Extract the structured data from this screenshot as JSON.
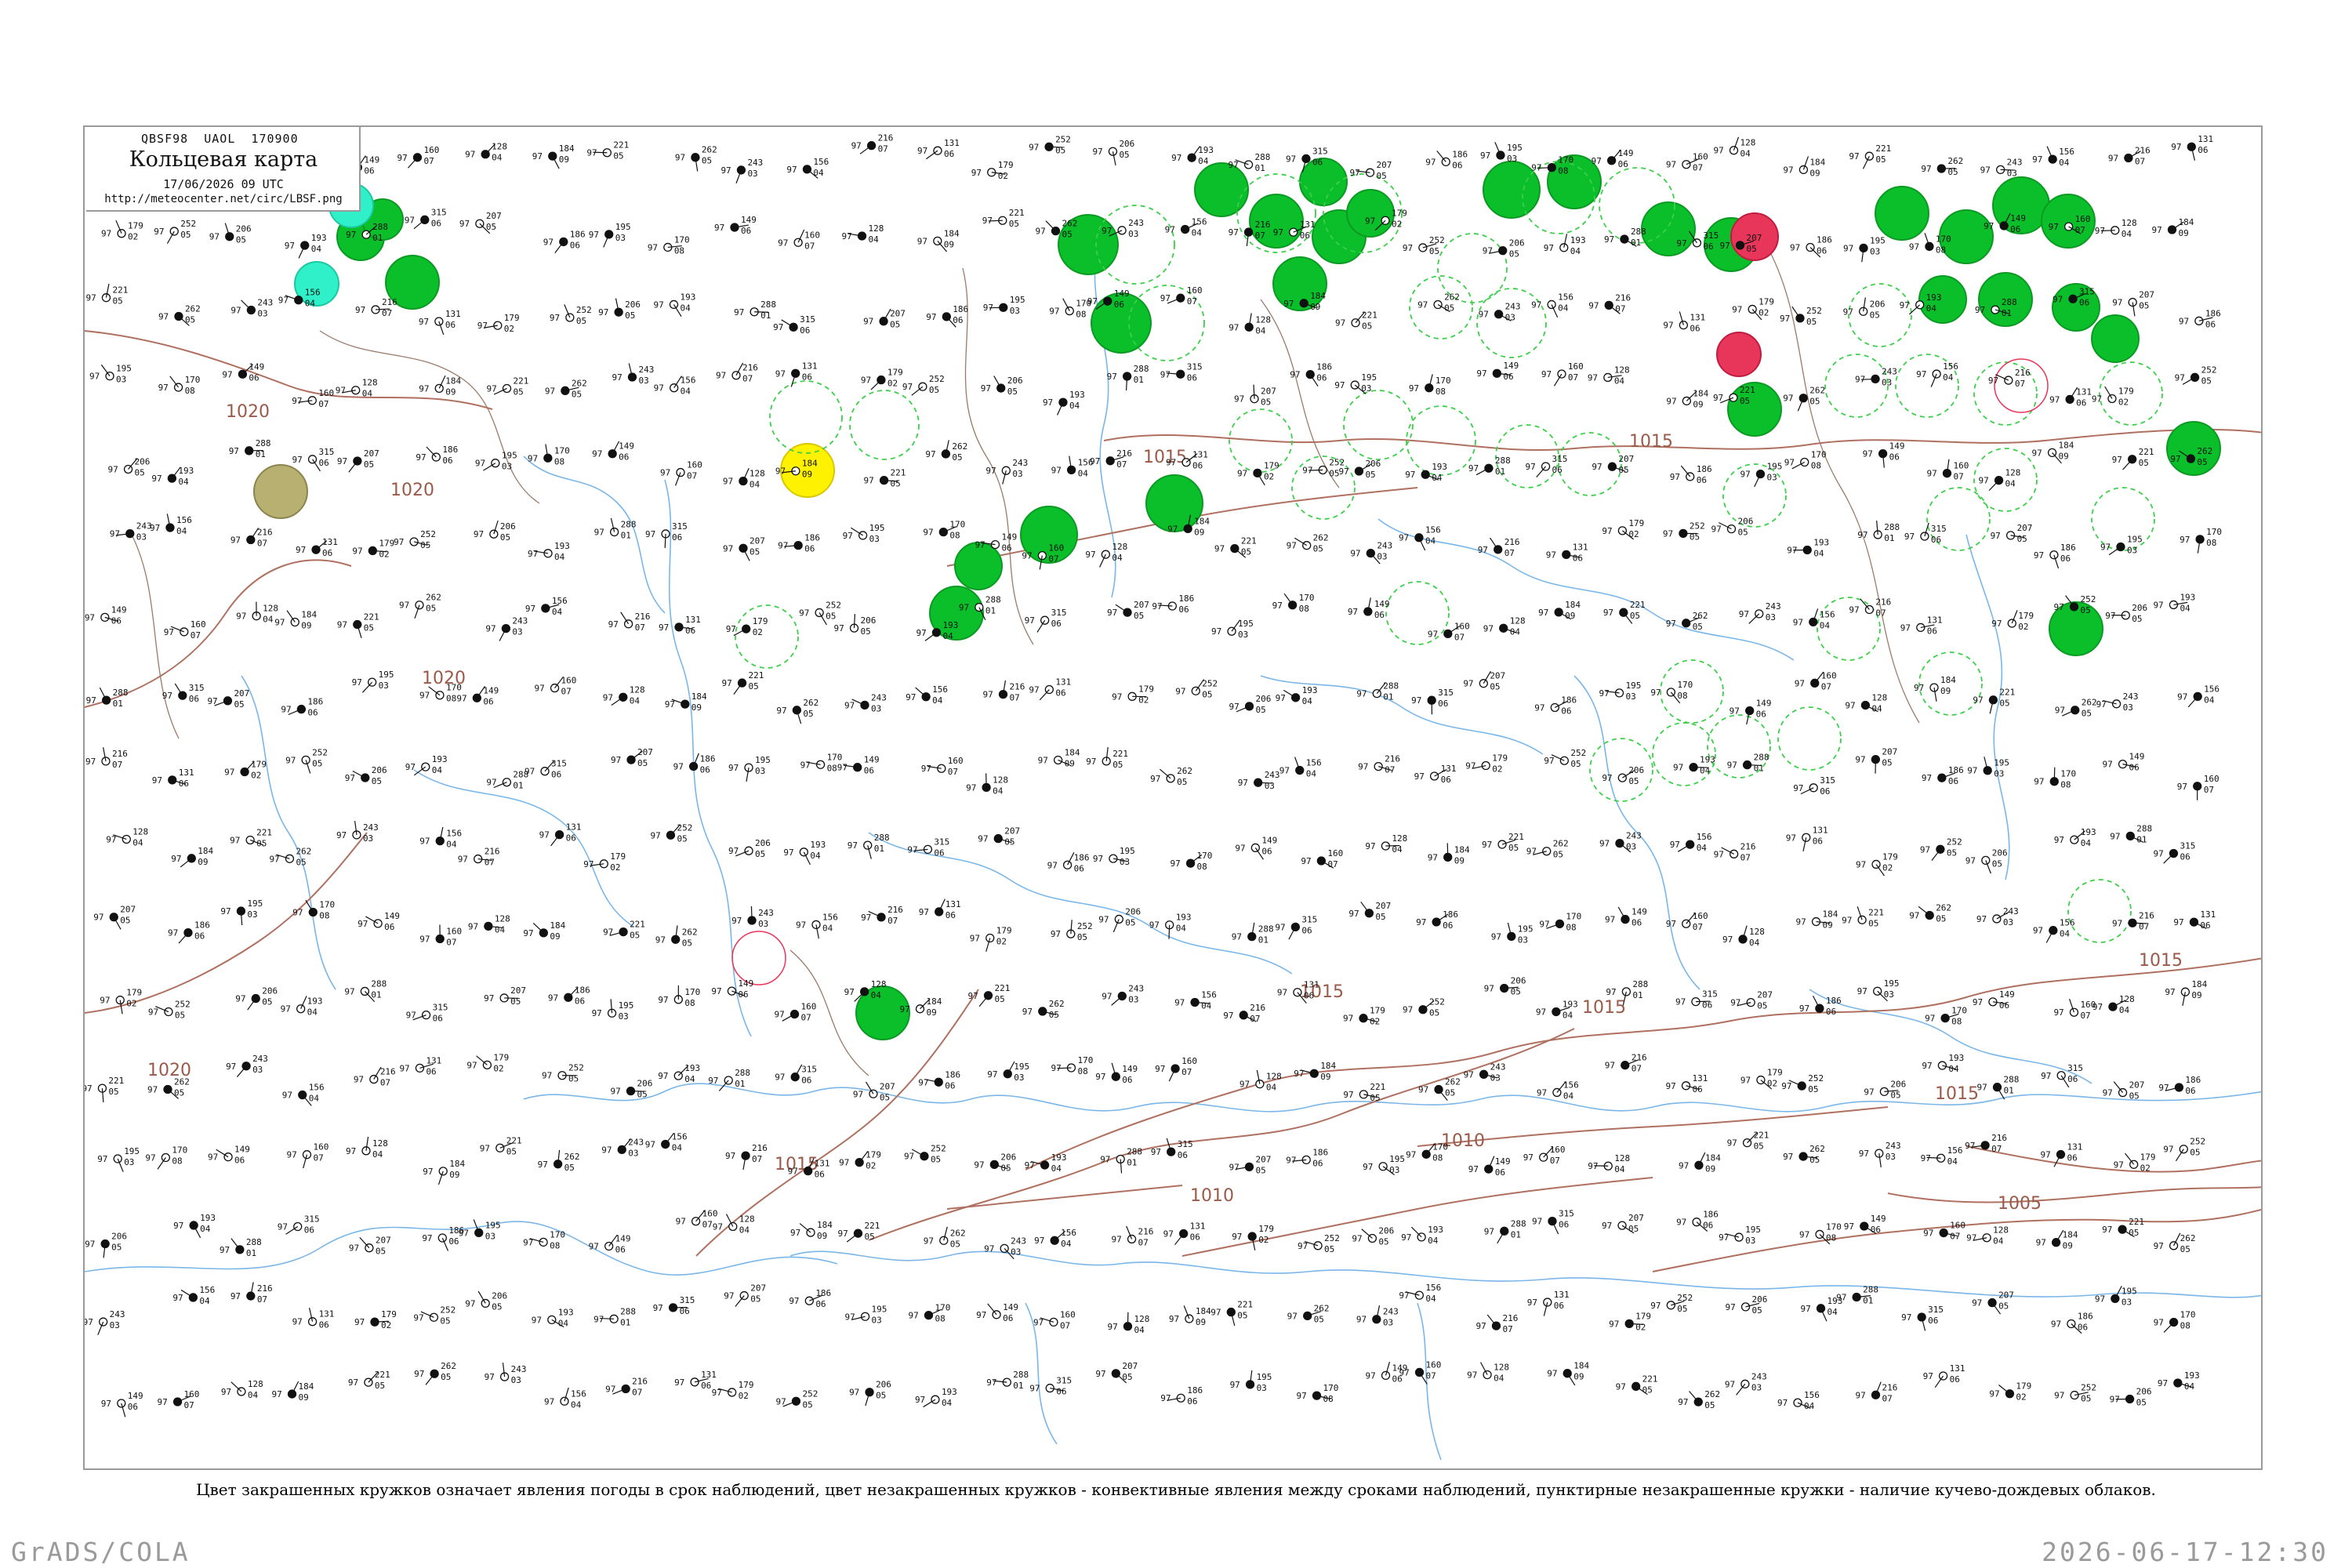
{
  "header": {
    "bulletin": "QBSF98  UAOL  170900",
    "title": "Кольцевая карта",
    "date": "17/06/2026 09 UTC",
    "url": "http://meteocenter.net/circ/LBSF.png"
  },
  "caption": "Цвет закрашенных кружков означает явления погоды в срок наблюдений, цвет незакрашенных кружков - конвективные явления между сроками наблюдений, пунктирные незакрашенные кружки - наличие кучево-дождевых облаков.",
  "footer": {
    "left": "GrADS/COLA",
    "right": "2026-06-17-12:30"
  },
  "isobars": [
    "1020",
    "1020",
    "1020",
    "1020",
    "1015",
    "1015",
    "1015",
    "1015",
    "1015",
    "1015",
    "1015",
    "1010",
    "1010",
    "1005"
  ],
  "colors": {
    "rain": "#0bbf2a",
    "shower": "#2ff0c8",
    "thunder": "#e8365a",
    "fog": "#fff200",
    "haze": "#b8b070",
    "cb_dashed": "#3ccf4a",
    "coast": "#7ab6e8",
    "isobar": "#b07060",
    "frame": "#9a9a9a"
  },
  "station_samples": [
    {
      "t": "207",
      "p": "97",
      "d": "05"
    },
    {
      "t": "186",
      "p": "97",
      "d": "06"
    },
    {
      "t": "195",
      "p": "97",
      "d": "03"
    },
    {
      "t": "170",
      "p": "97",
      "d": "08"
    },
    {
      "t": "149",
      "p": "97",
      "d": "06"
    },
    {
      "t": "160",
      "p": "97",
      "d": "07"
    },
    {
      "t": "128",
      "p": "97",
      "d": "04"
    },
    {
      "t": "184",
      "p": "97",
      "d": "09"
    },
    {
      "t": "221",
      "p": "97",
      "d": "05"
    },
    {
      "t": "262",
      "p": "97",
      "d": "05"
    },
    {
      "t": "243",
      "p": "97",
      "d": "03"
    },
    {
      "t": "156",
      "p": "97",
      "d": "04"
    },
    {
      "t": "216",
      "p": "97",
      "d": "07"
    },
    {
      "t": "131",
      "p": "97",
      "d": "06"
    },
    {
      "t": "179",
      "p": "97",
      "d": "02"
    },
    {
      "t": "252",
      "p": "97",
      "d": "05"
    },
    {
      "t": "206",
      "p": "97",
      "d": "05"
    },
    {
      "t": "193",
      "p": "97",
      "d": "04"
    },
    {
      "t": "288",
      "p": "97",
      "d": "01"
    },
    {
      "t": "315",
      "p": "97",
      "d": "06"
    }
  ]
}
